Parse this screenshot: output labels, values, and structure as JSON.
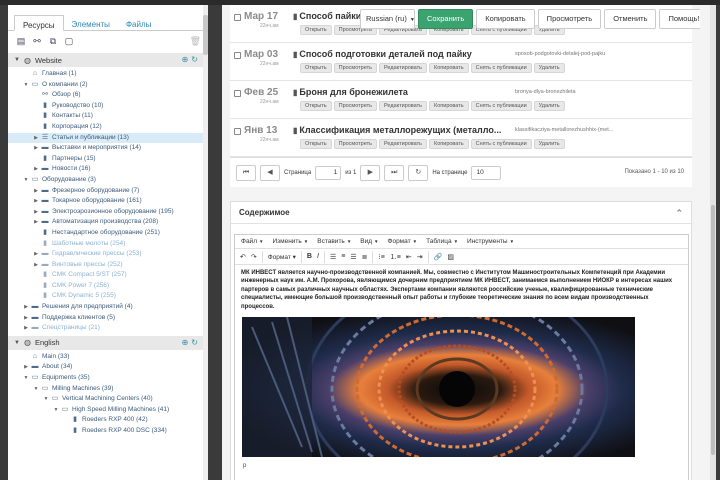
{
  "left": {
    "tabs": [
      "Ресурсы",
      "Элементы",
      "Файлы"
    ],
    "toolbar_icons": [
      "new-document-icon",
      "new-link-icon",
      "new-symlink-icon",
      "new-static-icon"
    ],
    "contexts": [
      {
        "name": "Website",
        "nodes": [
          {
            "label": "Главная (1)",
            "depth": 0,
            "arrow": "",
            "icon": "home"
          },
          {
            "label": "О компании (2)",
            "depth": 0,
            "arrow": "open",
            "icon": "folder-open"
          },
          {
            "label": "Обзор (6)",
            "depth": 1,
            "arrow": "",
            "icon": "link"
          },
          {
            "label": "Руководство (10)",
            "depth": 1,
            "arrow": "",
            "icon": "doc"
          },
          {
            "label": "Контакты (11)",
            "depth": 1,
            "arrow": "",
            "icon": "doc"
          },
          {
            "label": "Корпорация (12)",
            "depth": 1,
            "arrow": "",
            "icon": "doc"
          },
          {
            "label": "Статьи и публикации (13)",
            "depth": 1,
            "arrow": "closed",
            "icon": "list",
            "selected": true
          },
          {
            "label": "Выставки и мероприятия (14)",
            "depth": 1,
            "arrow": "closed",
            "icon": "folder"
          },
          {
            "label": "Партнеры (15)",
            "depth": 1,
            "arrow": "",
            "icon": "doc"
          },
          {
            "label": "Новости (16)",
            "depth": 1,
            "arrow": "closed",
            "icon": "folder"
          },
          {
            "label": "Оборудование (3)",
            "depth": 0,
            "arrow": "open",
            "icon": "folder-open"
          },
          {
            "label": "Фрезерное оборудование (7)",
            "depth": 1,
            "arrow": "closed",
            "icon": "folder"
          },
          {
            "label": "Токарное оборудование (161)",
            "depth": 1,
            "arrow": "closed",
            "icon": "folder"
          },
          {
            "label": "Электроэрозионное оборудование (195)",
            "depth": 1,
            "arrow": "closed",
            "icon": "folder"
          },
          {
            "label": "Автоматизация производства (208)",
            "depth": 1,
            "arrow": "closed",
            "icon": "folder"
          },
          {
            "label": "Нестандартное оборудование (251)",
            "depth": 1,
            "arrow": "",
            "icon": "doc"
          },
          {
            "label": "Шаботные молоты (254)",
            "depth": 1,
            "arrow": "",
            "icon": "doc",
            "muted": true
          },
          {
            "label": "Гидравлические прессы (253)",
            "depth": 1,
            "arrow": "closed",
            "icon": "folder",
            "muted": true
          },
          {
            "label": "Винтовые прессы (252)",
            "depth": 1,
            "arrow": "closed",
            "icon": "folder",
            "muted": true
          },
          {
            "label": "CMK Compact 5/ST (257)",
            "depth": 1,
            "arrow": "",
            "icon": "doc",
            "muted": true
          },
          {
            "label": "CMK Power 7 (256)",
            "depth": 1,
            "arrow": "",
            "icon": "doc",
            "muted": true
          },
          {
            "label": "CMK Dynamic 5 (255)",
            "depth": 1,
            "arrow": "",
            "icon": "doc",
            "muted": true
          },
          {
            "label": "Решения для предприятий (4)",
            "depth": 0,
            "arrow": "closed",
            "icon": "folder"
          },
          {
            "label": "Поддержка клиентов (5)",
            "depth": 0,
            "arrow": "closed",
            "icon": "folder"
          },
          {
            "label": "Спецстраницы (21)",
            "depth": 0,
            "arrow": "closed",
            "icon": "folder",
            "muted": true
          }
        ]
      },
      {
        "name": "English",
        "nodes": [
          {
            "label": "Main (33)",
            "depth": 0,
            "arrow": "",
            "icon": "home"
          },
          {
            "label": "About (34)",
            "depth": 0,
            "arrow": "closed",
            "icon": "folder"
          },
          {
            "label": "Equipments (35)",
            "depth": 0,
            "arrow": "open",
            "icon": "folder-open"
          },
          {
            "label": "Milling Machines (39)",
            "depth": 1,
            "arrow": "open",
            "icon": "folder-open"
          },
          {
            "label": "Vertical Machining Centers (40)",
            "depth": 2,
            "arrow": "open",
            "icon": "folder-open"
          },
          {
            "label": "High Speed Milling Machines (41)",
            "depth": 3,
            "arrow": "open",
            "icon": "folder-open"
          },
          {
            "label": "Roeders RXP 400 (42)",
            "depth": 4,
            "arrow": "",
            "icon": "doc"
          },
          {
            "label": "Roeders RXP 400 DSC (334)",
            "depth": 4,
            "arrow": "",
            "icon": "doc"
          }
        ]
      }
    ]
  },
  "toolbar": {
    "language": "Russian (ru)",
    "save": "Сохранить",
    "copy": "Копировать",
    "view": "Просмотреть",
    "cancel": "Отменить",
    "help": "Помощь!"
  },
  "rows": [
    {
      "date": "Мар 17",
      "time": "22нч.ам",
      "title": "Способ пайки",
      "alias": ""
    },
    {
      "date": "Мар 03",
      "time": "22нч.ам",
      "title": "Способ подготовки деталей под пайку",
      "alias": "sposob-podgotovki-detalej-pod-pajku"
    },
    {
      "date": "Фев 25",
      "time": "22нч.ам",
      "title": "Броня для бронежилета",
      "alias": "bronya-dlya-bronezhileta"
    },
    {
      "date": "Янв 13",
      "time": "22нч.ам",
      "title": "Классификация металлорежущих (металло...",
      "alias": "klassifikacziya-metallorezhushhix-(met..."
    }
  ],
  "row_actions": [
    "Открыть",
    "Просмотреть",
    "Редактировать",
    "Копировать",
    "Снять с публикации",
    "Удалить"
  ],
  "pager": {
    "page_label": "Страница",
    "page": "1",
    "of_label": "из 1",
    "per_page_label": "На странице",
    "per_page": "10",
    "info": "Показано 1 - 10 из 10"
  },
  "content": {
    "header": "Содержимое",
    "menu": [
      "Файл",
      "Изменить",
      "Вставить",
      "Вид",
      "Формат",
      "Таблица",
      "Инструменты"
    ],
    "format_label": "Формат",
    "text": "МК ИНВЕСТ является научно-производственной компанией. Мы, совместно с Институтом Машиностроительных Компетенций при Академии инженерных наук им. А.М. Прохорова, являющимся дочерним предприятием МК ИНВЕСТ, занимаемся выполнением НИОКР в интересах наших партеров в самых различных научных областях. Экспертами компании являются российские ученые, квалифицированные технические специалисты, имеющие большой производственный опыт работы  и глубокие теоретические знания по всем видам производственных процессов.",
    "status": "p"
  },
  "colors": {
    "accent": "#2a8ab8",
    "save": "#3aa36f",
    "selected": "#d9ebf7"
  }
}
